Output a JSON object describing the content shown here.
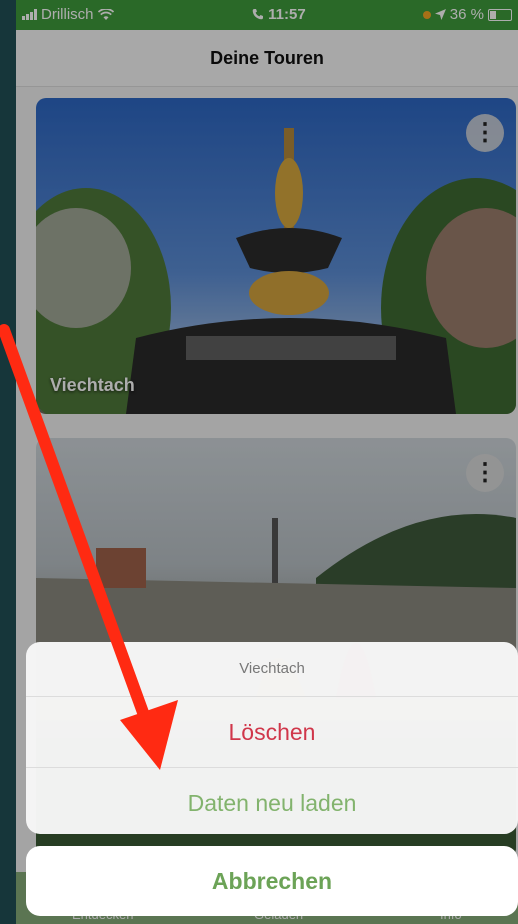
{
  "status_bar": {
    "carrier": "Drillisch",
    "time": "11:57",
    "battery": "36 %"
  },
  "nav": {
    "title": "Deine Touren"
  },
  "tours": [
    {
      "name": "Viechtach"
    },
    {
      "name": ""
    }
  ],
  "tabbar": {
    "tab1": "Entdecken",
    "tab2": "Geladen",
    "tab3": "Info"
  },
  "action_sheet": {
    "title": "Viechtach",
    "delete_label": "Löschen",
    "reload_label": "Daten neu laden",
    "cancel_label": "Abbrechen"
  },
  "colors": {
    "status_green": "#3f9b3c",
    "delete_red": "#d0364a",
    "action_green": "#82b36d",
    "arrow_red": "#ff2a12"
  },
  "icons": [
    "wifi-icon",
    "phone-icon",
    "location-arrow-icon",
    "more-vertical-icon"
  ]
}
